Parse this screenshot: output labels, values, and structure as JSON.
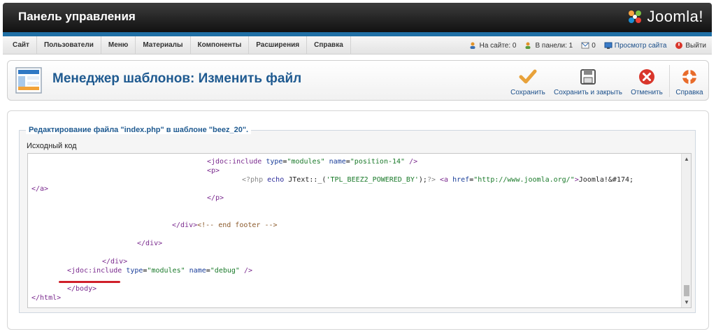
{
  "header": {
    "title": "Панель управления",
    "brand": "Joomla!"
  },
  "menu": {
    "items": [
      "Сайт",
      "Пользователи",
      "Меню",
      "Материалы",
      "Компоненты",
      "Расширения",
      "Справка"
    ]
  },
  "status": {
    "on_site": "На сайте: 0",
    "in_panel": "В панели: 1",
    "messages": "0",
    "view_site": "Просмотр сайта",
    "logout": "Выйти"
  },
  "toolbar": {
    "title": "Менеджер шаблонов: Изменить файл",
    "save": "Сохранить",
    "save_close": "Сохранить и закрыть",
    "cancel": "Отменить",
    "help": "Справка"
  },
  "editor": {
    "legend": "Редактирование файла \"index.php\" в шаблоне \"beez_20\".",
    "source_label": "Исходный код"
  },
  "colors": {
    "accent_blue": "#1f6fa5",
    "title_blue": "#1f5a90",
    "save_orange": "#e8a23a",
    "cancel_red": "#d9362b",
    "underline_red": "#d0202a"
  }
}
